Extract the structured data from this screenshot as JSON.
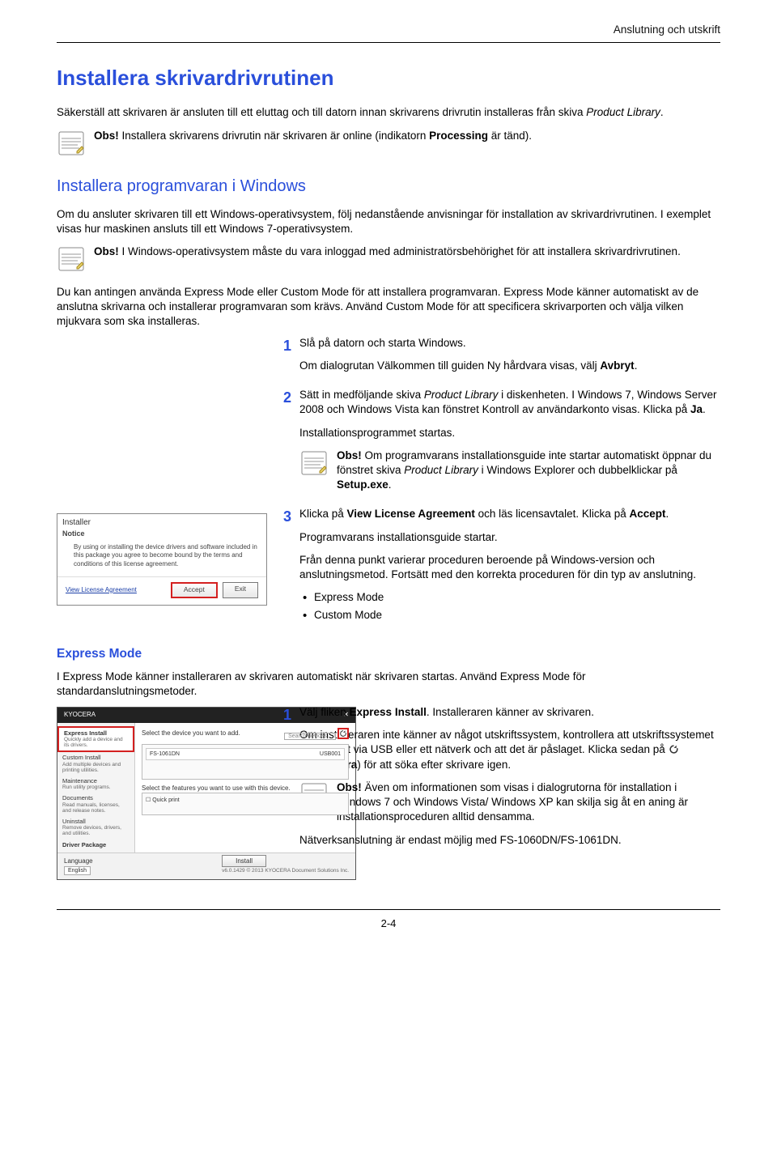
{
  "header_region": "Anslutning och utskrift",
  "h1": "Installera skrivardrivrutinen",
  "intro": {
    "p1_a": "Säkerställ att skrivaren är ansluten till ett eluttag och till datorn innan skrivarens drivrutin installeras från skiva ",
    "p1_italic": "Product Library",
    "p1_b": "."
  },
  "obs1": {
    "label": "Obs! ",
    "text_a": "Installera skrivarens drivrutin när skrivaren är online (indikatorn ",
    "text_bold": "Processing",
    "text_b": " är tänd)."
  },
  "h2": "Installera programvaran i Windows",
  "win_intro": "Om du ansluter skrivaren till ett Windows-operativsystem, följ nedanstående anvisningar för installation av skrivardrivrutinen. I exemplet visas hur maskinen ansluts till ett Windows 7-operativsystem.",
  "obs2": {
    "label": "Obs! ",
    "text": "I Windows-operativsystem måste du vara inloggad med administratörsbehörighet för att installera skrivardrivrutinen."
  },
  "win_modes": "Du kan antingen använda Express Mode eller Custom Mode för att installera programvaran. Express Mode känner automatiskt av de anslutna skrivarna och installerar programvaran som krävs. Använd Custom Mode för att specificera skrivarporten och välja vilken mjukvara som ska installeras.",
  "step1": {
    "num": "1",
    "p1": "Slå på datorn och starta Windows.",
    "p2_a": "Om dialogrutan Välkommen till guiden Ny hårdvara visas, välj ",
    "p2_bold": "Avbryt",
    "p2_b": "."
  },
  "step2": {
    "num": "2",
    "p1_a": "Sätt in medföljande skiva ",
    "p1_italic": "Product Library",
    "p1_b": " i diskenheten. I Windows 7, Windows Server 2008 och Windows Vista kan fönstret Kontroll av användarkonto visas. Klicka på ",
    "p1_bold": "Ja",
    "p1_c": ".",
    "p2": "Installationsprogrammet startas.",
    "obs_label": "Obs! ",
    "obs_a": "Om programvarans installationsguide inte startar automatiskt öppnar du fönstret skiva ",
    "obs_italic": "Product Library",
    "obs_b": " i Windows Explorer och dubbelklickar på ",
    "obs_bold": "Setup.exe",
    "obs_c": "."
  },
  "step3": {
    "num": "3",
    "p1_a": "Klicka på ",
    "p1_bold1": "View License Agreement",
    "p1_b": " och läs licensavtalet. Klicka på ",
    "p1_bold2": "Accept",
    "p1_c": ".",
    "p2": "Programvarans installationsguide startar.",
    "p3": "Från denna punkt varierar proceduren beroende på Windows-version och anslutningsmetod. Fortsätt med den korrekta proceduren för din typ av anslutning.",
    "b1": "Express Mode",
    "b2": "Custom Mode"
  },
  "notice_dlg": {
    "title": "Installer",
    "sub": "Notice",
    "body": "By using or installing the device drivers and software included in this package you agree to become bound by the terms and conditions of this license agreement.",
    "link": "View License Agreement",
    "accept": "Accept",
    "exit": "Exit"
  },
  "h3_express": "Express Mode",
  "express_intro": "I Express Mode känner installeraren av skrivaren automatiskt när skrivaren startas. Använd Express Mode för standardanslutningsmetoder.",
  "exp_step1": {
    "num": "1",
    "p1_a": "Välj fliken ",
    "p1_bold": "Express Install",
    "p1_b": ". Installeraren känner av skrivaren.",
    "p2_a": "Om installeraren inte känner av något utskriftssystem, kontrollera att utskriftssystemet är anslutet via USB eller ett nätverk och att det är påslaget. Klicka sedan på ",
    "p2_bold": "Uppdatera",
    "p2_b": ") för att söka efter skrivare igen.",
    "p2_paren": " (",
    "obs_label": "Obs! ",
    "obs_text": "Även om informationen som visas i dialogrutorna för installation i Windows 7 och Windows Vista/ Windows XP kan skilja sig åt en aning är installationsproceduren alltid densamma.",
    "p3": "Nätverksanslutning är endast möjlig med FS-1060DN/FS-1061DN."
  },
  "installer_dlg": {
    "brand": "KYOCERA",
    "side": {
      "express": "Express Install",
      "express_desc": "Quickly add a device and its drivers.",
      "custom": "Custom Install",
      "custom_desc": "Add multiple devices and printing utilities.",
      "maintenance": "Maintenance",
      "maintenance_desc": "Run utility programs.",
      "docs": "Documents",
      "docs_desc": "Read manuals, licenses, and release notes.",
      "uninstall": "Uninstall",
      "uninstall_desc": "Remove devices, drivers, and utilities.",
      "package": "Driver Package"
    },
    "main": {
      "prompt1": "Select the device you want to add.",
      "search_ph": "Search devices...",
      "dev_name": "FS-1061DN",
      "dev_detail": "USB001",
      "prompt2": "Select the features you want to use with this device.",
      "qp": "Quick print"
    },
    "lang_label": "Language",
    "lang_value": "English",
    "install_btn": "Install",
    "copy": "v6.0.1429 © 2013 KYOCERA Document Solutions Inc."
  },
  "footer_page": "2-4"
}
